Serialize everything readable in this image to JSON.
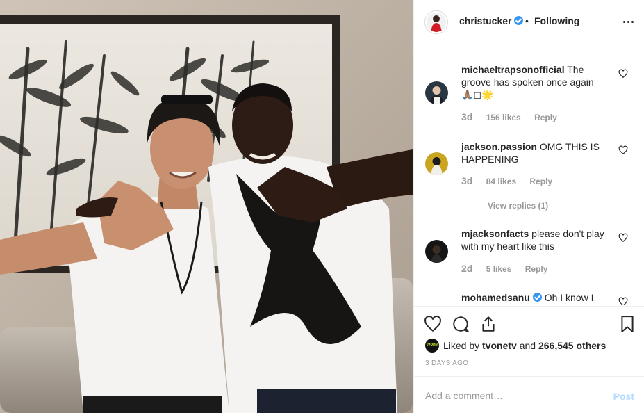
{
  "post": {
    "author": "christucker",
    "verified": true,
    "separator": "•",
    "follow_status": "Following",
    "more_icon": "more-options-icon"
  },
  "comments": [
    {
      "username": "michaeltrapsonofficial",
      "text": " The groove has spoken once again",
      "emoji_line": "🙏🏽◻︎🌟",
      "time": "3d",
      "likes": "156 likes",
      "reply": "Reply"
    },
    {
      "username": "jackson.passion",
      "text": " OMG THIS IS HAPPENING",
      "time": "3d",
      "likes": "84 likes",
      "reply": "Reply",
      "view_replies": "View replies (1)"
    },
    {
      "username": "mjacksonfacts",
      "text": " please don't play with my heart like this",
      "time": "2d",
      "likes": "5 likes",
      "reply": "Reply"
    },
    {
      "username": "mohamedsanu",
      "verified": true,
      "text": " Oh I know I"
    }
  ],
  "actions": {
    "like_icon": "heart-icon",
    "comment_icon": "comment-icon",
    "share_icon": "share-icon",
    "save_icon": "bookmark-icon"
  },
  "likes_summary": {
    "prefix": "Liked by ",
    "first_user": "tvonetv",
    "middle": " and ",
    "others": "266,545 others",
    "mini_avatar_text": "tvone"
  },
  "date": "3 DAYS AGO",
  "comment_box": {
    "placeholder": "Add a comment…",
    "post_label": "Post"
  },
  "colors": {
    "accent_blue": "#3897f0",
    "post_disabled": "#b3dbff",
    "muted": "#999999"
  }
}
